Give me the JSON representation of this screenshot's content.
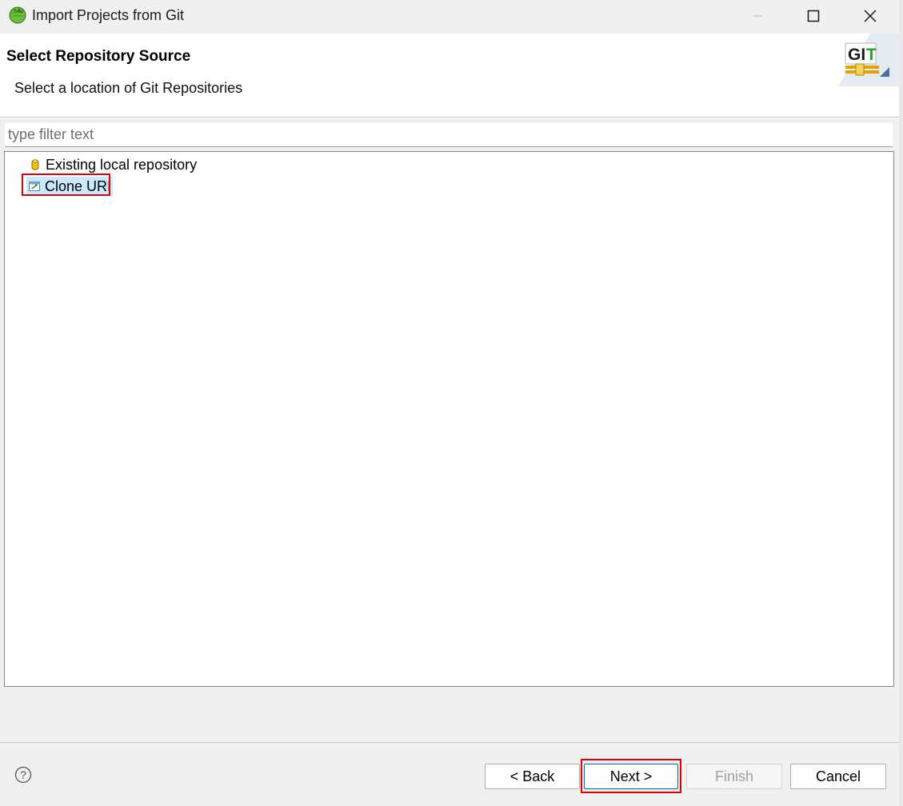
{
  "window": {
    "title": "Import Projects from Git",
    "app_icon": "eclipse-globe-icon",
    "controls": [
      "minimize-icon",
      "maximize-icon",
      "close-icon"
    ]
  },
  "banner": {
    "title": "Select Repository Source",
    "description": "Select a location of Git Repositories",
    "logo_text": "GIT",
    "logo_colors": {
      "g": "#1a1a1a",
      "i": "#1a1a1a",
      "t": "#2e9b2e"
    }
  },
  "filter": {
    "value": "",
    "placeholder": "type filter text"
  },
  "tree": {
    "items": [
      {
        "label": "Existing local repository",
        "icon": "repository-cylinder-icon",
        "selected": false
      },
      {
        "label": "Clone URI",
        "icon": "clone-uri-icon",
        "selected": true
      }
    ]
  },
  "buttons": {
    "back": "< Back",
    "next": "Next >",
    "finish": "Finish",
    "cancel": "Cancel"
  },
  "colors": {
    "selection": "#cce8ff",
    "annotation": "#e00000"
  }
}
